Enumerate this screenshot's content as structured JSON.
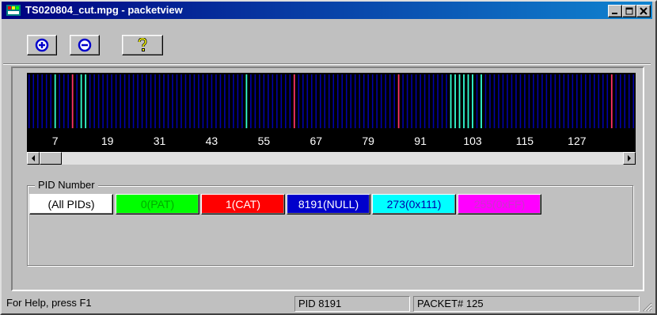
{
  "window": {
    "title": "TS020804_cut.mpg - packetview",
    "minimize_label": "_",
    "maximize_label": "□",
    "close_label": "×"
  },
  "toolbar": {
    "buttons": [
      {
        "name": "zoom-in-button",
        "icon": "zoom-in-icon"
      },
      {
        "name": "zoom-out-button",
        "icon": "zoom-out-icon"
      },
      {
        "name": "help-button",
        "icon": "help-icon"
      }
    ]
  },
  "packet_strip": {
    "base_color": "#0000aa",
    "packet_count": 140,
    "highlights": [
      {
        "packet": 6,
        "color": "#33ffcc"
      },
      {
        "packet": 10,
        "color": "#ff3366"
      },
      {
        "packet": 12,
        "color": "#33ffcc"
      },
      {
        "packet": 13,
        "color": "#33ffcc"
      },
      {
        "packet": 50,
        "color": "#33ffcc"
      },
      {
        "packet": 61,
        "color": "#ff3366"
      },
      {
        "packet": 85,
        "color": "#ff3366"
      },
      {
        "packet": 97,
        "color": "#33ffcc"
      },
      {
        "packet": 98,
        "color": "#33ffcc"
      },
      {
        "packet": 99,
        "color": "#33ffcc"
      },
      {
        "packet": 100,
        "color": "#33ffcc"
      },
      {
        "packet": 101,
        "color": "#33ffcc"
      },
      {
        "packet": 102,
        "color": "#33ffcc"
      },
      {
        "packet": 104,
        "color": "#33ffcc"
      },
      {
        "packet": 134,
        "color": "#ff3366"
      }
    ]
  },
  "axis": {
    "ticks": [
      "7",
      "19",
      "31",
      "43",
      "55",
      "67",
      "79",
      "91",
      "103",
      "115",
      "127"
    ]
  },
  "pid_group": {
    "label": "PID Number",
    "buttons": [
      {
        "label": "(All PIDs)",
        "bg": "#ffffff",
        "fg": "#000000"
      },
      {
        "label": "0(PAT)",
        "bg": "#00ff00",
        "fg": "#00aa00"
      },
      {
        "label": "1(CAT)",
        "bg": "#ff0000",
        "fg": "#ffffff"
      },
      {
        "label": "8191(NULL)",
        "bg": "#0000cc",
        "fg": "#ffffff"
      },
      {
        "label": "273(0x111)",
        "bg": "#00ffff",
        "fg": "#0000aa"
      },
      {
        "label": "255(0xFF)",
        "bg": "#ff00ff",
        "fg": "#cc33cc"
      }
    ]
  },
  "statusbar": {
    "help": "For Help, press F1",
    "pid": "PID 8191",
    "packet": "PACKET# 125",
    "extra": ""
  }
}
